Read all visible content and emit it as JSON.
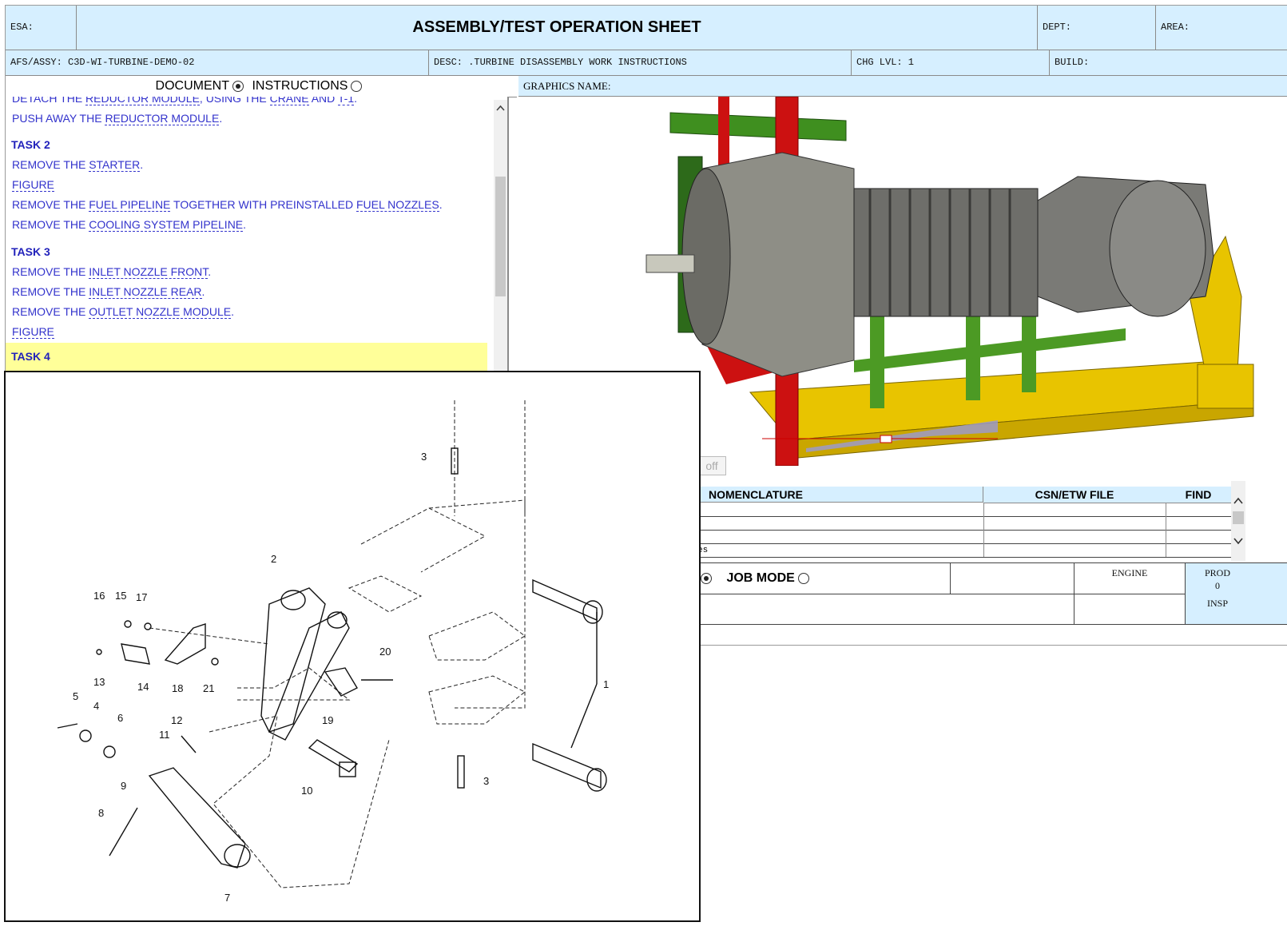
{
  "header": {
    "esa_label": "ESA:",
    "title": "ASSEMBLY/TEST OPERATION SHEET",
    "dept_label": "DEPT:",
    "area_label": "AREA:",
    "afs_assy": "AFS/ASSY: C3D-WI-TURBINE-DEMO-02",
    "desc": "DESC: .TURBINE DISASSEMBLY WORK INSTRUCTIONS",
    "chg_lvl": "CHG LVL: 1",
    "build": "BUILD:"
  },
  "tabs": {
    "document": "DOCUMENT",
    "instructions": "INSTRUCTIONS",
    "selected": "document"
  },
  "graphics_name_label": "GRAPHICS NAME:",
  "instructions": {
    "top_clipped": {
      "pre": "DETACH THE ",
      "link1": "REDUCTOR MODULE",
      "mid": ", USING THE ",
      "link2": "CRANE",
      "mid2": " AND ",
      "link3": "T-1",
      "post": "."
    },
    "push": {
      "pre": "PUSH AWAY THE ",
      "link": "REDUCTOR MODULE",
      "post": "."
    },
    "task2": "TASK 2",
    "t2_l1": {
      "pre": "REMOVE THE ",
      "link": "STARTER",
      "post": "."
    },
    "t2_fig": "FIGURE",
    "t2_l2": {
      "pre": "REMOVE THE ",
      "link": "FUEL PIPELINE",
      "mid": " TOGETHER WITH PREINSTALLED ",
      "link2": "FUEL NOZZLES",
      "post": "."
    },
    "t2_l3": {
      "pre": "REMOVE THE ",
      "link": "COOLING SYSTEM PIPELINE",
      "post": "."
    },
    "task3": "TASK 3",
    "t3_l1": {
      "pre": "REMOVE THE ",
      "link": "INLET NOZZLE FRONT",
      "post": "."
    },
    "t3_l2": {
      "pre": "REMOVE THE ",
      "link": "INLET NOZZLE REAR",
      "post": "."
    },
    "t3_l3": {
      "pre": "REMOVE THE ",
      "link": "OUTLET NOZZLE MODULE",
      "post": "."
    },
    "t3_fig": "FIGURE",
    "task4": "TASK 4"
  },
  "viewer": {
    "off_button": "off"
  },
  "parts_table": {
    "columns": [
      "NOMENCLATURE",
      "CSN/ETW FILE",
      "FIND"
    ],
    "partial_cell": "es"
  },
  "modes": {
    "job_mode": "JOB MODE"
  },
  "footer": {
    "engine": "ENGINE",
    "prod": "PROD",
    "prod_value": "0",
    "insp": "INSP"
  },
  "diagram_callouts": [
    "1",
    "2",
    "3",
    "3",
    "4",
    "5",
    "6",
    "7",
    "8",
    "9",
    "10",
    "11",
    "12",
    "13",
    "14",
    "15",
    "16",
    "17",
    "18",
    "19",
    "20",
    "21"
  ],
  "colors": {
    "header_bg": "#d6efff",
    "link_blue": "#3333cc",
    "task_highlight": "#ffff99"
  }
}
